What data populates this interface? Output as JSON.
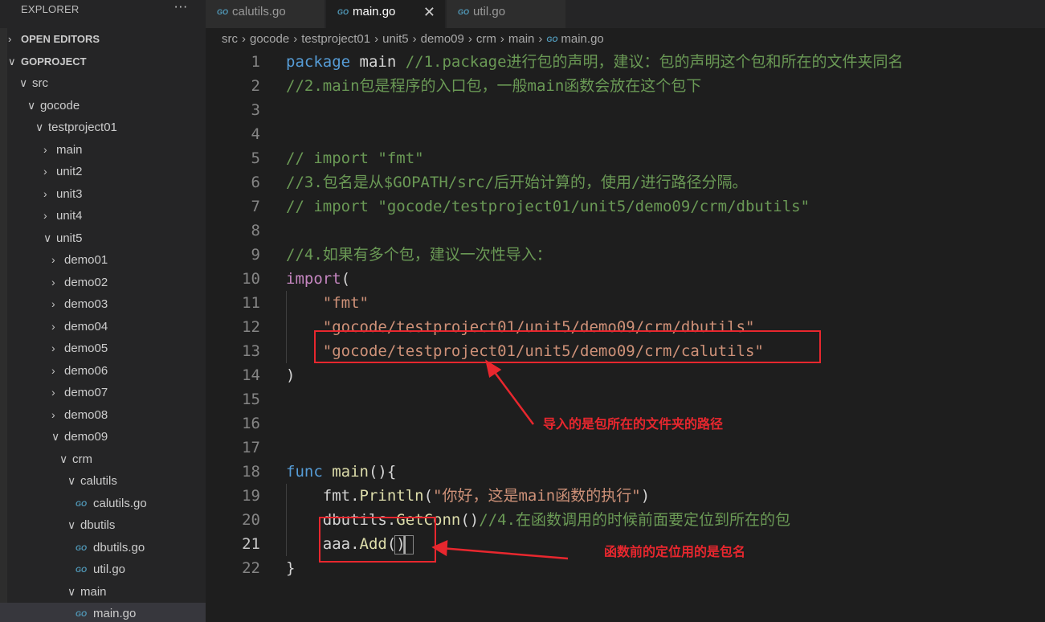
{
  "explorer": {
    "title": "EXPLORER",
    "more": "···",
    "open_editors": "OPEN EDITORS",
    "project": "GOPROJECT",
    "tree": [
      {
        "label": "src",
        "chev": "∨"
      },
      {
        "label": "gocode",
        "chev": "∨"
      },
      {
        "label": "testproject01",
        "chev": "∨"
      },
      {
        "label": "main",
        "chev": "›"
      },
      {
        "label": "unit2",
        "chev": "›"
      },
      {
        "label": "unit3",
        "chev": "›"
      },
      {
        "label": "unit4",
        "chev": "›"
      },
      {
        "label": "unit5",
        "chev": "∨"
      },
      {
        "label": "demo01",
        "chev": "›"
      },
      {
        "label": "demo02",
        "chev": "›"
      },
      {
        "label": "demo03",
        "chev": "›"
      },
      {
        "label": "demo04",
        "chev": "›"
      },
      {
        "label": "demo05",
        "chev": "›"
      },
      {
        "label": "demo06",
        "chev": "›"
      },
      {
        "label": "demo07",
        "chev": "›"
      },
      {
        "label": "demo08",
        "chev": "›"
      },
      {
        "label": "demo09",
        "chev": "∨"
      },
      {
        "label": "crm",
        "chev": "∨"
      },
      {
        "label": "calutils",
        "chev": "∨"
      },
      {
        "label": "calutils.go",
        "icon": "GO"
      },
      {
        "label": "dbutils",
        "chev": "∨"
      },
      {
        "label": "dbutils.go",
        "icon": "GO"
      },
      {
        "label": "util.go",
        "icon": "GO"
      },
      {
        "label": "main",
        "chev": "∨"
      },
      {
        "label": "main.go",
        "icon": "GO",
        "selected": true
      }
    ]
  },
  "tabs": [
    {
      "label": "calutils.go",
      "icon": "GO",
      "active": false
    },
    {
      "label": "main.go",
      "icon": "GO",
      "active": true,
      "close": "✕"
    },
    {
      "label": "util.go",
      "icon": "GO",
      "active": false
    }
  ],
  "breadcrumb": {
    "parts": [
      "src",
      "gocode",
      "testproject01",
      "unit5",
      "demo09",
      "crm",
      "main"
    ],
    "file": "main.go",
    "file_icon": "GO",
    "separator": "›"
  },
  "editor": {
    "current_line": 21,
    "line_numbers": [
      "1",
      "2",
      "3",
      "4",
      "5",
      "6",
      "7",
      "8",
      "9",
      "10",
      "11",
      "12",
      "13",
      "14",
      "15",
      "16",
      "17",
      "18",
      "19",
      "20",
      "21",
      "22"
    ],
    "lines": [
      [
        {
          "t": "package ",
          "c": "kw"
        },
        {
          "t": "main ",
          "c": "pl"
        },
        {
          "t": "//1.package进行包的声明，建议：包的声明这个包和所在的文件夹同名",
          "c": "cm"
        }
      ],
      [
        {
          "t": "//2.main包是程序的入口包，一般main函数会放在这个包下",
          "c": "cm"
        }
      ],
      [],
      [],
      [
        {
          "t": "// import \"fmt\"",
          "c": "cm"
        }
      ],
      [
        {
          "t": "//3.包名是从$GOPATH/src/后开始计算的，使用/进行路径分隔。",
          "c": "cm"
        }
      ],
      [
        {
          "t": "// import \"gocode/testproject01/unit5/demo09/crm/dbutils\"",
          "c": "cm"
        }
      ],
      [],
      [
        {
          "t": "//4.如果有多个包，建议一次性导入：",
          "c": "cm"
        }
      ],
      [
        {
          "t": "import",
          "c": "kwc"
        },
        {
          "t": "(",
          "c": "pl"
        }
      ],
      [
        {
          "t": "    ",
          "c": "pl"
        },
        {
          "t": "\"fmt\"",
          "c": "st"
        }
      ],
      [
        {
          "t": "    ",
          "c": "pl"
        },
        {
          "t": "\"gocode/testproject01/unit5/demo09/crm/dbutils\"",
          "c": "st"
        }
      ],
      [
        {
          "t": "    ",
          "c": "pl"
        },
        {
          "t": "\"gocode/testproject01/unit5/demo09/crm/calutils\"",
          "c": "st"
        }
      ],
      [
        {
          "t": ")",
          "c": "pl"
        }
      ],
      [],
      [],
      [],
      [
        {
          "t": "func ",
          "c": "kw"
        },
        {
          "t": "main",
          "c": "fn"
        },
        {
          "t": "(){",
          "c": "pl"
        }
      ],
      [
        {
          "t": "    fmt.",
          "c": "pl"
        },
        {
          "t": "Println",
          "c": "fn"
        },
        {
          "t": "(",
          "c": "pl"
        },
        {
          "t": "\"你好，这是main函数的执行\"",
          "c": "st"
        },
        {
          "t": ")",
          "c": "pl"
        }
      ],
      [
        {
          "t": "    dbutils.",
          "c": "pl"
        },
        {
          "t": "GetConn",
          "c": "fn"
        },
        {
          "t": "()",
          "c": "pl"
        },
        {
          "t": "//4.在函数调用的时候前面要定位到所在的包",
          "c": "cm"
        }
      ],
      [
        {
          "t": "    aaa.",
          "c": "pl"
        },
        {
          "t": "Add",
          "c": "fn"
        },
        {
          "t": "()",
          "c": "pl"
        }
      ],
      [
        {
          "t": "}",
          "c": "pl"
        }
      ]
    ]
  },
  "annotations": {
    "import_note": "导入的是包所在的文件夹的路径",
    "call_note": "函数前的定位用的是包名",
    "color": "#e8272e"
  }
}
